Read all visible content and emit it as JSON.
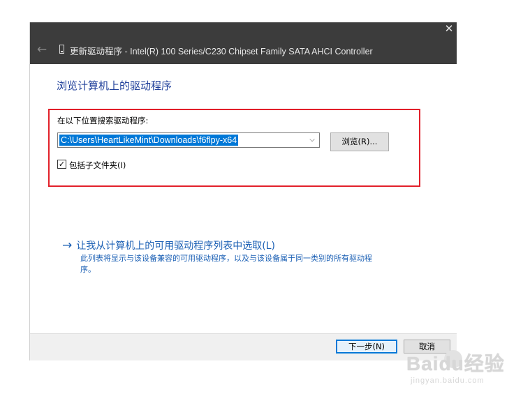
{
  "window": {
    "title": "更新驱动程序 - Intel(R) 100 Series/C230 Chipset Family SATA AHCI Controller",
    "back_icon": "←",
    "close_icon": "✕"
  },
  "heading": "浏览计算机上的驱动程序",
  "search": {
    "label": "在以下位置搜索驱动程序:",
    "path_value": "C:\\Users\\HeartLikeMint\\Downloads\\f6flpy-x64",
    "dropdown_icon": "⌵",
    "browse_label": "浏览(R)...",
    "include_subfolders_checked": true,
    "include_subfolders_mark": "✓",
    "include_subfolders_label": "包括子文件夹(I)"
  },
  "pick_option": {
    "arrow_icon": "→",
    "label": "让我从计算机上的可用驱动程序列表中选取(L)",
    "description": "此列表将显示与该设备兼容的可用驱动程序，以及与该设备属于同一类别的所有驱动程序。"
  },
  "footer": {
    "next_label": "下一步(N)",
    "cancel_label": "取消"
  },
  "watermark": {
    "main": "Baidu经验",
    "sub": "jingyan.baidu.com"
  },
  "colors": {
    "titlebar": "#3c3c3c",
    "heading": "#1f3f9a",
    "link": "#1a5fb4",
    "highlight_box": "#e2202a",
    "selection": "#0078d7"
  }
}
